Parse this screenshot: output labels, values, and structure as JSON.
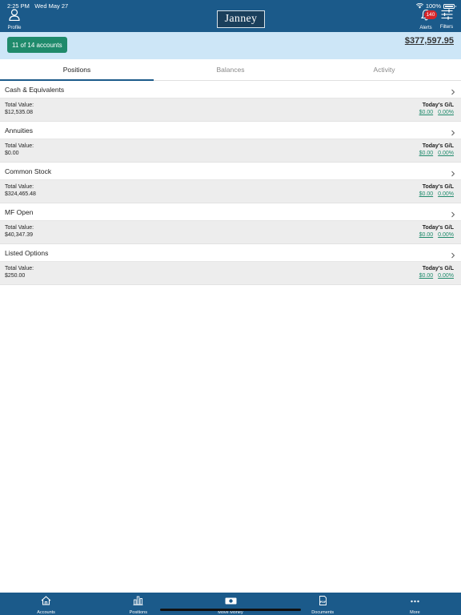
{
  "status_bar": {
    "time": "2:25 PM",
    "date": "Wed May 27",
    "battery": "100%"
  },
  "header": {
    "profile_label": "Profile",
    "logo_text": "Janney",
    "alerts_label": "Alerts",
    "alerts_count": "140",
    "filters_label": "Filters"
  },
  "account_bar": {
    "accounts_selector": "11 of 14 accounts",
    "total_value": "$377,597.95"
  },
  "tabs": [
    {
      "label": "Positions",
      "active": true
    },
    {
      "label": "Balances",
      "active": false
    },
    {
      "label": "Activity",
      "active": false
    }
  ],
  "categories": [
    {
      "name": "Cash & Equivalents",
      "total_label": "Total Value:",
      "total_value": "$12,535.08",
      "gl_label": "Today's G/L",
      "gl_amount": "$0.00",
      "gl_percent": "0.00%"
    },
    {
      "name": "Annuities",
      "total_label": "Total Value:",
      "total_value": "$0.00",
      "gl_label": "Today's G/L",
      "gl_amount": "$0.00",
      "gl_percent": "0.00%"
    },
    {
      "name": "Common Stock",
      "total_label": "Total Value:",
      "total_value": "$324,465.48",
      "gl_label": "Today's G/L",
      "gl_amount": "$0.00",
      "gl_percent": "0.00%"
    },
    {
      "name": "MF Open",
      "total_label": "Total Value:",
      "total_value": "$40,347.39",
      "gl_label": "Today's G/L",
      "gl_amount": "$0.00",
      "gl_percent": "0.00%"
    },
    {
      "name": "Listed Options",
      "total_label": "Total Value:",
      "total_value": "$250.00",
      "gl_label": "Today's G/L",
      "gl_amount": "$0.00",
      "gl_percent": "0.00%"
    }
  ],
  "bottom_nav": [
    {
      "label": "Accounts",
      "icon": "home-icon"
    },
    {
      "label": "Positions",
      "icon": "bar-chart-icon"
    },
    {
      "label": "Move Money",
      "icon": "money-icon"
    },
    {
      "label": "Documents",
      "icon": "pdf-icon"
    },
    {
      "label": "More",
      "icon": "more-icon"
    }
  ],
  "colors": {
    "primary": "#1b5a8a",
    "account_bar": "#cde6f7",
    "accent_green": "#1f8a6b",
    "badge_red": "#d6252a"
  }
}
